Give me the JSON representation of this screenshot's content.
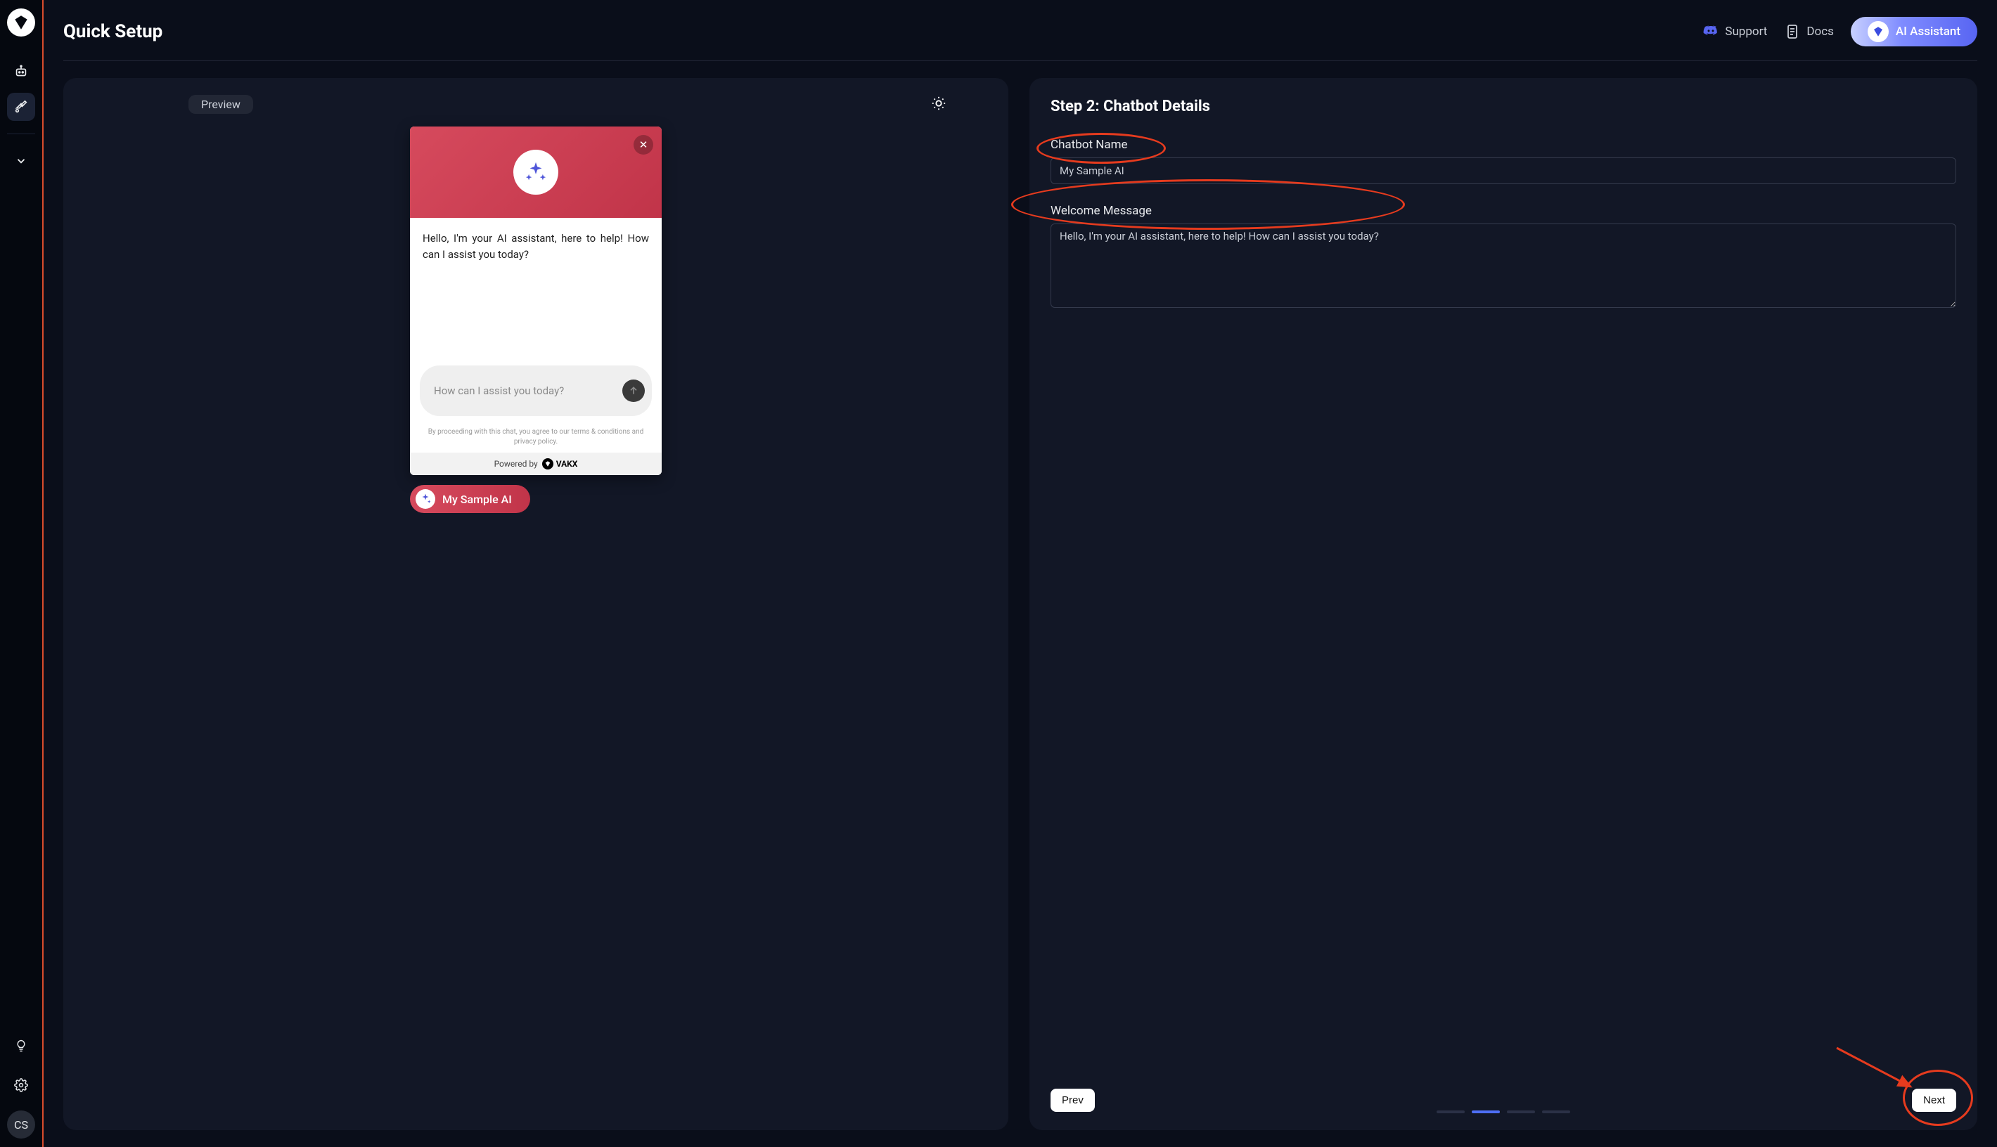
{
  "page": {
    "title": "Quick Setup"
  },
  "header": {
    "support_label": "Support",
    "docs_label": "Docs",
    "ai_assistant_label": "AI Assistant"
  },
  "sidebar": {
    "avatar_initials": "CS"
  },
  "preview": {
    "label": "Preview",
    "chat_greeting": "Hello, I'm your AI assistant, here to help! How can I assist you today?",
    "input_placeholder": "How can I assist you today?",
    "disclaimer": "By proceeding with this chat, you agree to our terms & conditions and privacy policy.",
    "powered_by": "Powered by",
    "powered_brand": "VAKX",
    "sample_pill": "My Sample AI"
  },
  "form": {
    "step_title": "Step 2: Chatbot Details",
    "name_label": "Chatbot Name",
    "name_value": "My Sample AI",
    "welcome_label": "Welcome Message",
    "welcome_value": "Hello, I'm your AI assistant, here to help! How can I assist you today?",
    "prev_label": "Prev",
    "next_label": "Next",
    "steps_total": 4,
    "steps_current": 2
  }
}
